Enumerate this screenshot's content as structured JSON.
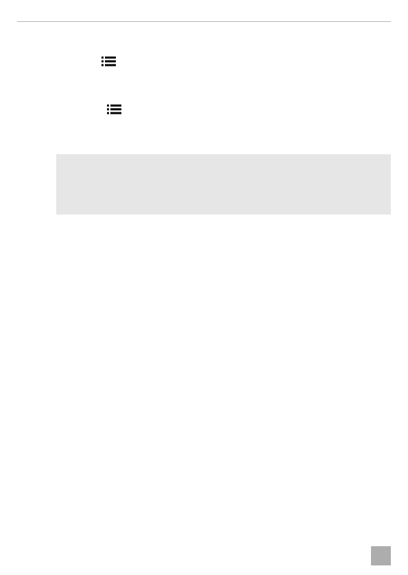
{
  "page": {
    "header_rule_color": "#b5b5b5",
    "background": "#ffffff"
  },
  "icons": [
    {
      "name": "list-icon",
      "color": "#000000"
    },
    {
      "name": "list-icon",
      "color": "#000000"
    }
  ],
  "note_box": {
    "background": "#e6e6e6",
    "text": ""
  },
  "page_badge": {
    "background": "#adadad",
    "text": ""
  }
}
